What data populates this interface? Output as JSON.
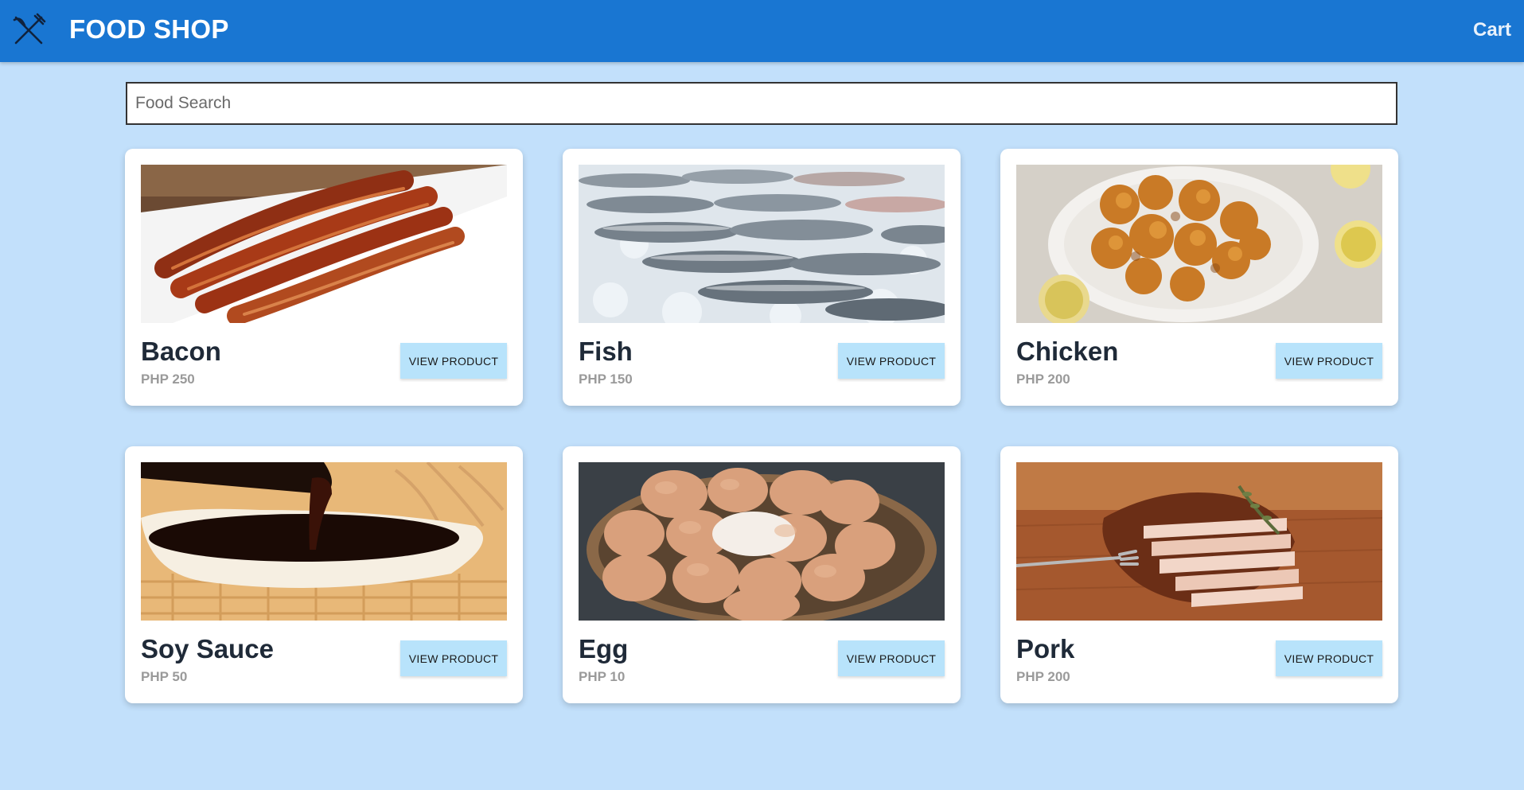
{
  "header": {
    "brand": "FOOD SHOP",
    "cart_label": "Cart",
    "logo_icon": "fork-knife-icon"
  },
  "search": {
    "placeholder": "Food Search",
    "value": ""
  },
  "products": [
    {
      "name": "Bacon",
      "price": "PHP 250",
      "button": "VIEW PRODUCT",
      "image": "bacon-photo"
    },
    {
      "name": "Fish",
      "price": "PHP 150",
      "button": "VIEW PRODUCT",
      "image": "fish-photo"
    },
    {
      "name": "Chicken",
      "price": "PHP 200",
      "button": "VIEW PRODUCT",
      "image": "fried-chicken-photo"
    },
    {
      "name": "Soy Sauce",
      "price": "PHP 50",
      "button": "VIEW PRODUCT",
      "image": "soy-sauce-photo"
    },
    {
      "name": "Egg",
      "price": "PHP 10",
      "button": "VIEW PRODUCT",
      "image": "eggs-photo"
    },
    {
      "name": "Pork",
      "price": "PHP 200",
      "button": "VIEW PRODUCT",
      "image": "pork-photo"
    }
  ],
  "colors": {
    "header": "#1976d2",
    "background": "#c2e0fb",
    "button": "#b8e3fb"
  }
}
